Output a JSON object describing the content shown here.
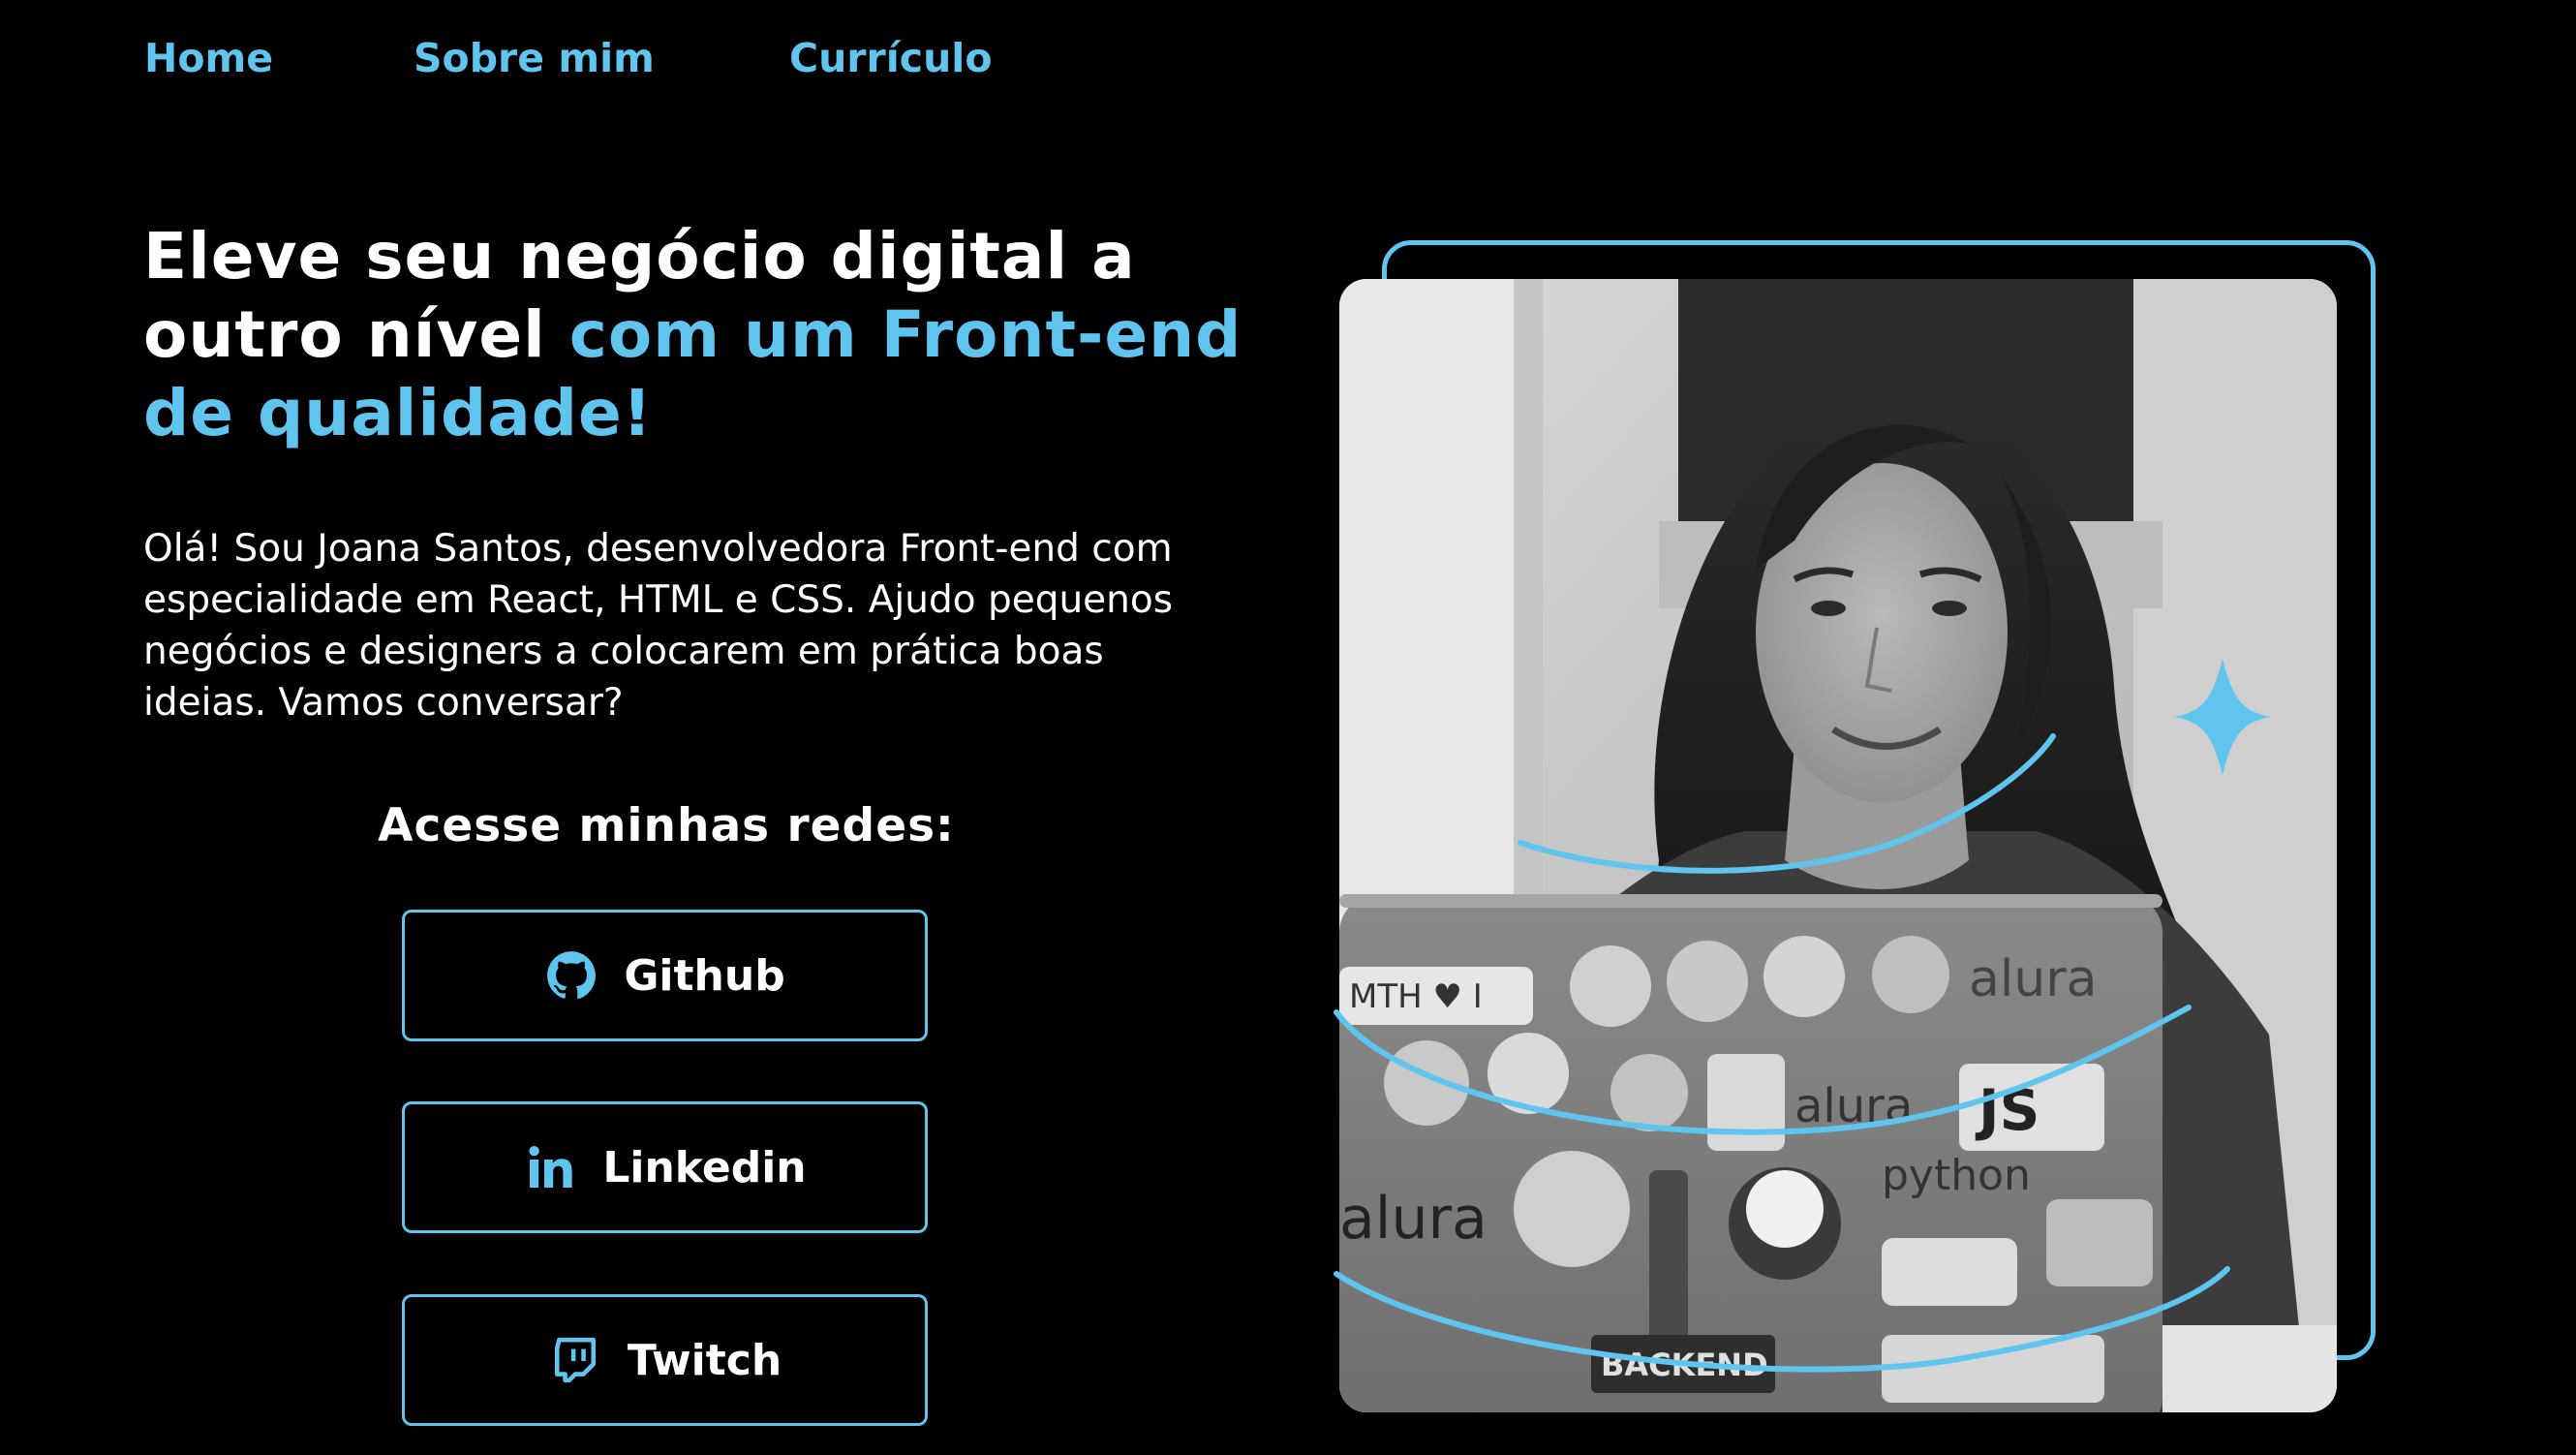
{
  "nav": {
    "items": [
      "Home",
      "Sobre mim",
      "Currículo"
    ]
  },
  "hero": {
    "headline_plain": "Eleve seu negócio digital a outro nível ",
    "headline_accent": "com um Front-end de qualidade!",
    "intro": "Olá! Sou Joana Santos, desenvolvedora Front-end com especialidade em React, HTML e CSS. Ajudo pequenos negócios e designers a colocarem em prática boas ideias. Vamos conversar?"
  },
  "socials": {
    "title": "Acesse minhas redes:",
    "buttons": [
      {
        "label": "Github",
        "icon": "github-icon"
      },
      {
        "label": "Linkedin",
        "icon": "linkedin-icon"
      },
      {
        "label": "Twitch",
        "icon": "twitch-icon"
      }
    ]
  },
  "photo": {
    "sticker_texts": [
      "MTH ♥ I",
      "alura",
      "alura",
      "JS",
      "python",
      "alura",
      "BACKEND"
    ]
  },
  "colors": {
    "background": "#000000",
    "accent": "#5fc4ee",
    "text": "#ffffff"
  }
}
